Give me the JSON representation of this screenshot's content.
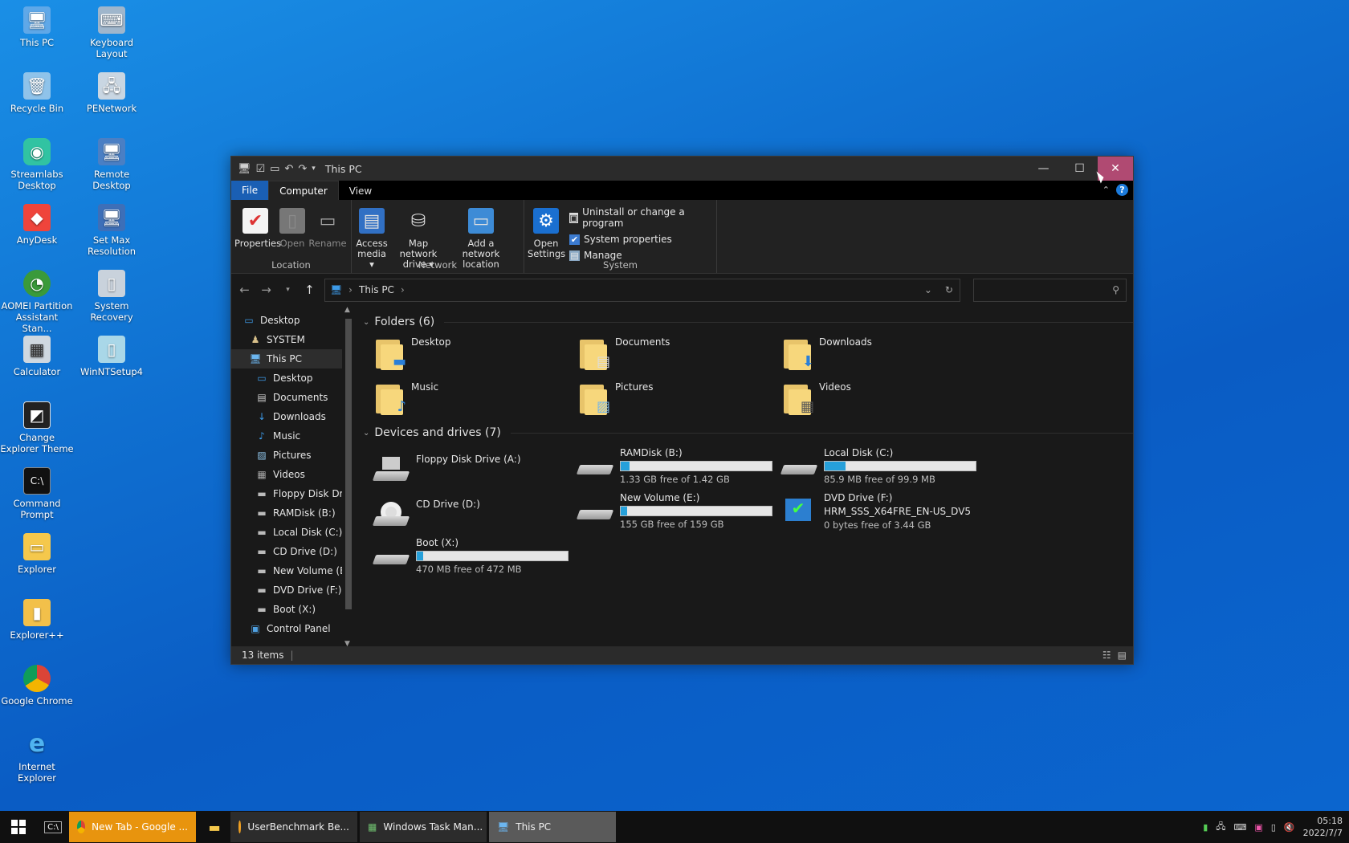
{
  "desktop": {
    "icons": [
      {
        "label": "This PC",
        "icon": "computer-icon"
      },
      {
        "label": "Keyboard Layout",
        "icon": "keyboard-icon"
      },
      {
        "label": "Recycle Bin",
        "icon": "recycle-bin-icon"
      },
      {
        "label": "PENetwork",
        "icon": "network-icon"
      },
      {
        "label": "Streamlabs Desktop",
        "icon": "streamlabs-icon"
      },
      {
        "label": "Remote Desktop",
        "icon": "remote-desktop-icon"
      },
      {
        "label": "AnyDesk",
        "icon": "anydesk-icon"
      },
      {
        "label": "Set Max Resolution",
        "icon": "resolution-icon"
      },
      {
        "label": "AOMEI Partition Assistant Stan...",
        "icon": "aomei-icon"
      },
      {
        "label": "System Recovery",
        "icon": "recovery-icon"
      },
      {
        "label": "Calculator",
        "icon": "calculator-icon"
      },
      {
        "label": "WinNTSetup4",
        "icon": "winntsetup-icon"
      },
      {
        "label": "Change Explorer Theme",
        "icon": "theme-icon"
      },
      {
        "label": "Command Prompt",
        "icon": "cmd-icon"
      },
      {
        "label": "Explorer",
        "icon": "explorer-icon"
      },
      {
        "label": "Explorer++",
        "icon": "explorer-plus-icon"
      },
      {
        "label": "Google Chrome",
        "icon": "chrome-icon"
      },
      {
        "label": "Internet Explorer",
        "icon": "ie-icon"
      }
    ]
  },
  "window": {
    "title": "This PC",
    "tabs": {
      "file": "File",
      "computer": "Computer",
      "view": "View"
    },
    "ribbon": {
      "location": {
        "label": "Location",
        "properties": "Properties",
        "open": "Open",
        "rename": "Rename"
      },
      "network": {
        "label": "Network",
        "access_media_1": "Access",
        "access_media_2": "media ▾",
        "map_drive_1": "Map network",
        "map_drive_2": "drive ▾",
        "add_location_1": "Add a network",
        "add_location_2": "location"
      },
      "system": {
        "label": "System",
        "open_settings_1": "Open",
        "open_settings_2": "Settings",
        "uninstall": "Uninstall or change a program",
        "system_properties": "System properties",
        "manage": "Manage"
      }
    },
    "address": {
      "path": "This PC",
      "search_placeholder": ""
    },
    "nav": [
      {
        "label": "Desktop",
        "indent": 0
      },
      {
        "label": "SYSTEM",
        "indent": 1
      },
      {
        "label": "This PC",
        "indent": 1
      },
      {
        "label": "Desktop",
        "indent": 2
      },
      {
        "label": "Documents",
        "indent": 2
      },
      {
        "label": "Downloads",
        "indent": 2
      },
      {
        "label": "Music",
        "indent": 2
      },
      {
        "label": "Pictures",
        "indent": 2
      },
      {
        "label": "Videos",
        "indent": 2
      },
      {
        "label": "Floppy Disk Dri",
        "indent": 2
      },
      {
        "label": "RAMDisk (B:)",
        "indent": 2
      },
      {
        "label": "Local Disk (C:)",
        "indent": 2
      },
      {
        "label": "CD Drive (D:)",
        "indent": 2
      },
      {
        "label": "New Volume (E",
        "indent": 2
      },
      {
        "label": "DVD Drive (F:) I",
        "indent": 2
      },
      {
        "label": "Boot (X:)",
        "indent": 2
      },
      {
        "label": "Control Panel",
        "indent": 1
      }
    ],
    "folders_header": "Folders (6)",
    "folders": [
      "Desktop",
      "Documents",
      "Downloads",
      "Music",
      "Pictures",
      "Videos"
    ],
    "drives_header": "Devices and drives (7)",
    "drives": [
      {
        "name": "Floppy Disk Drive (A:)",
        "free": "",
        "fill": null
      },
      {
        "name": "RAMDisk (B:)",
        "free": "1.33 GB free of 1.42 GB",
        "fill": 0.06
      },
      {
        "name": "Local Disk (C:)",
        "free": "85.9 MB free of 99.9 MB",
        "fill": 0.14
      },
      {
        "name": "CD Drive (D:)",
        "free": "",
        "fill": null
      },
      {
        "name": "New Volume (E:)",
        "free": "155 GB free of 159 GB",
        "fill": 0.025
      },
      {
        "name": "DVD Drive (F:)",
        "label2": "HRM_SSS_X64FRE_EN-US_DV5",
        "free": "0 bytes free of 3.44 GB",
        "fill": null
      },
      {
        "name": "Boot (X:)",
        "free": "470 MB free of 472 MB",
        "fill": 0.004
      }
    ],
    "status": "13 items"
  },
  "taskbar": {
    "buttons": [
      {
        "label": "New Tab - Google ..."
      },
      {
        "label": "UserBenchmark Be..."
      },
      {
        "label": "Windows Task Man..."
      },
      {
        "label": "This PC"
      }
    ],
    "clock_time": "05:18",
    "clock_date": "2022/7/7"
  }
}
